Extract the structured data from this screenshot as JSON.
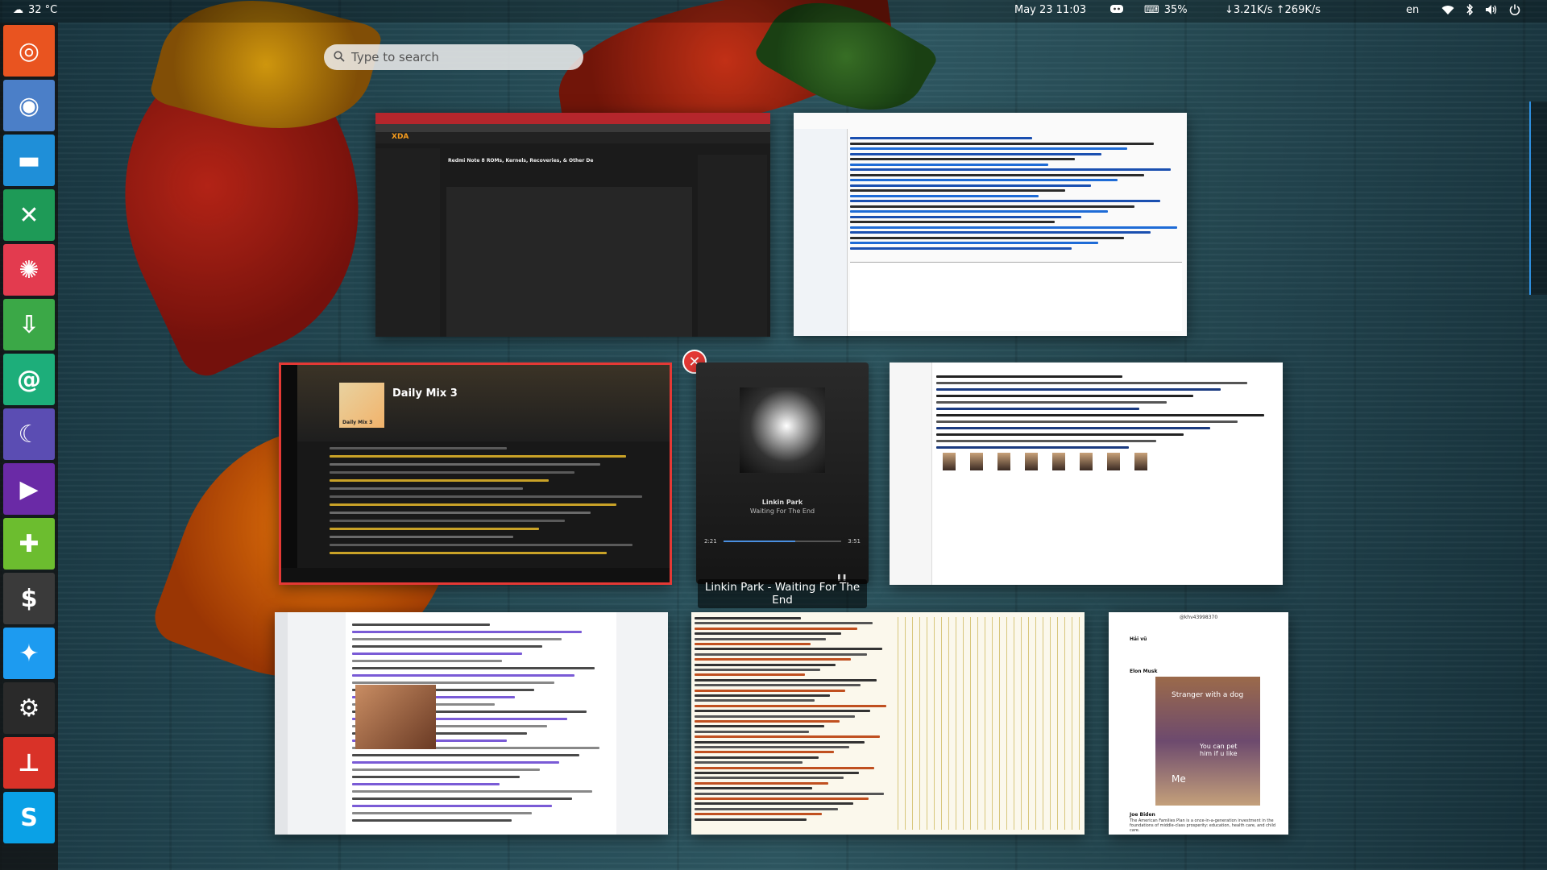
{
  "topbar": {
    "weather": "32 °C",
    "datetime": "May 23  11:03",
    "battery": "35%",
    "network_speed": "↓3.21K/s ↑269K/s",
    "language": "en",
    "icons": [
      "cloud-icon",
      "discord-icon",
      "keyboard-battery-icon",
      "wifi-icon",
      "bluetooth-icon",
      "volume-icon",
      "power-icon"
    ]
  },
  "search": {
    "placeholder": "Type to search"
  },
  "dock": {
    "items": [
      {
        "name": "ubuntu",
        "color": "#e95420",
        "glyph": "◎"
      },
      {
        "name": "chromium",
        "color": "#4b7fc8",
        "glyph": "◉"
      },
      {
        "name": "file-manager",
        "color": "#1f8fd8",
        "glyph": "▬"
      },
      {
        "name": "xda",
        "color": "#1e9a57",
        "glyph": "✕"
      },
      {
        "name": "aperture",
        "color": "#e33b4f",
        "glyph": "✺"
      },
      {
        "name": "downloader",
        "color": "#3ba847",
        "glyph": "⇩"
      },
      {
        "name": "mail",
        "color": "#1dae7a",
        "glyph": "@"
      },
      {
        "name": "crescent",
        "color": "#5b4db3",
        "glyph": "☾"
      },
      {
        "name": "media-player",
        "color": "#6a2aa6",
        "glyph": "▶"
      },
      {
        "name": "game",
        "color": "#6cbd2f",
        "glyph": "✚"
      },
      {
        "name": "terminal",
        "color": "#3a3a3a",
        "glyph": "$"
      },
      {
        "name": "twitter",
        "color": "#1d9bf0",
        "glyph": "✦"
      },
      {
        "name": "steam",
        "color": "#2a2a2a",
        "glyph": "⚙"
      },
      {
        "name": "hotspot",
        "color": "#d93228",
        "glyph": "⊥"
      },
      {
        "name": "skype",
        "color": "#0aa1e6",
        "glyph": "S"
      }
    ]
  },
  "windows": {
    "xda": {
      "site_label": "XDA",
      "heading": "Redmi Note 8 ROMs, Kernels, Recoveries, & Other De"
    },
    "spotify": {
      "playlist_title": "Daily Mix 3",
      "cover_label": "Daily Mix 3"
    },
    "music_widget": {
      "artist": "Linkin Park",
      "track": "Waiting For The End",
      "time_elapsed": "2:21",
      "time_total": "3:51",
      "progress": 0.61,
      "caption": "Linkin Park - Waiting For The End"
    },
    "twitter": {
      "handle": "@khv43998370",
      "user1": "Hải vũ",
      "user2": "Elon Musk",
      "meme_caption": "Stranger with a dog",
      "meme_text1": "You can pet him if u like",
      "meme_text2": "Me",
      "user3": "Joe Biden",
      "tweet3": "The American Families Plan is a once-in-a-generation investment in the foundations of middle-class prosperity: education, health care, and child care."
    }
  },
  "close_button": {
    "glyph": "✕"
  },
  "colors": {
    "selected_border": "#e53935",
    "accent": "#1d9bf0"
  }
}
